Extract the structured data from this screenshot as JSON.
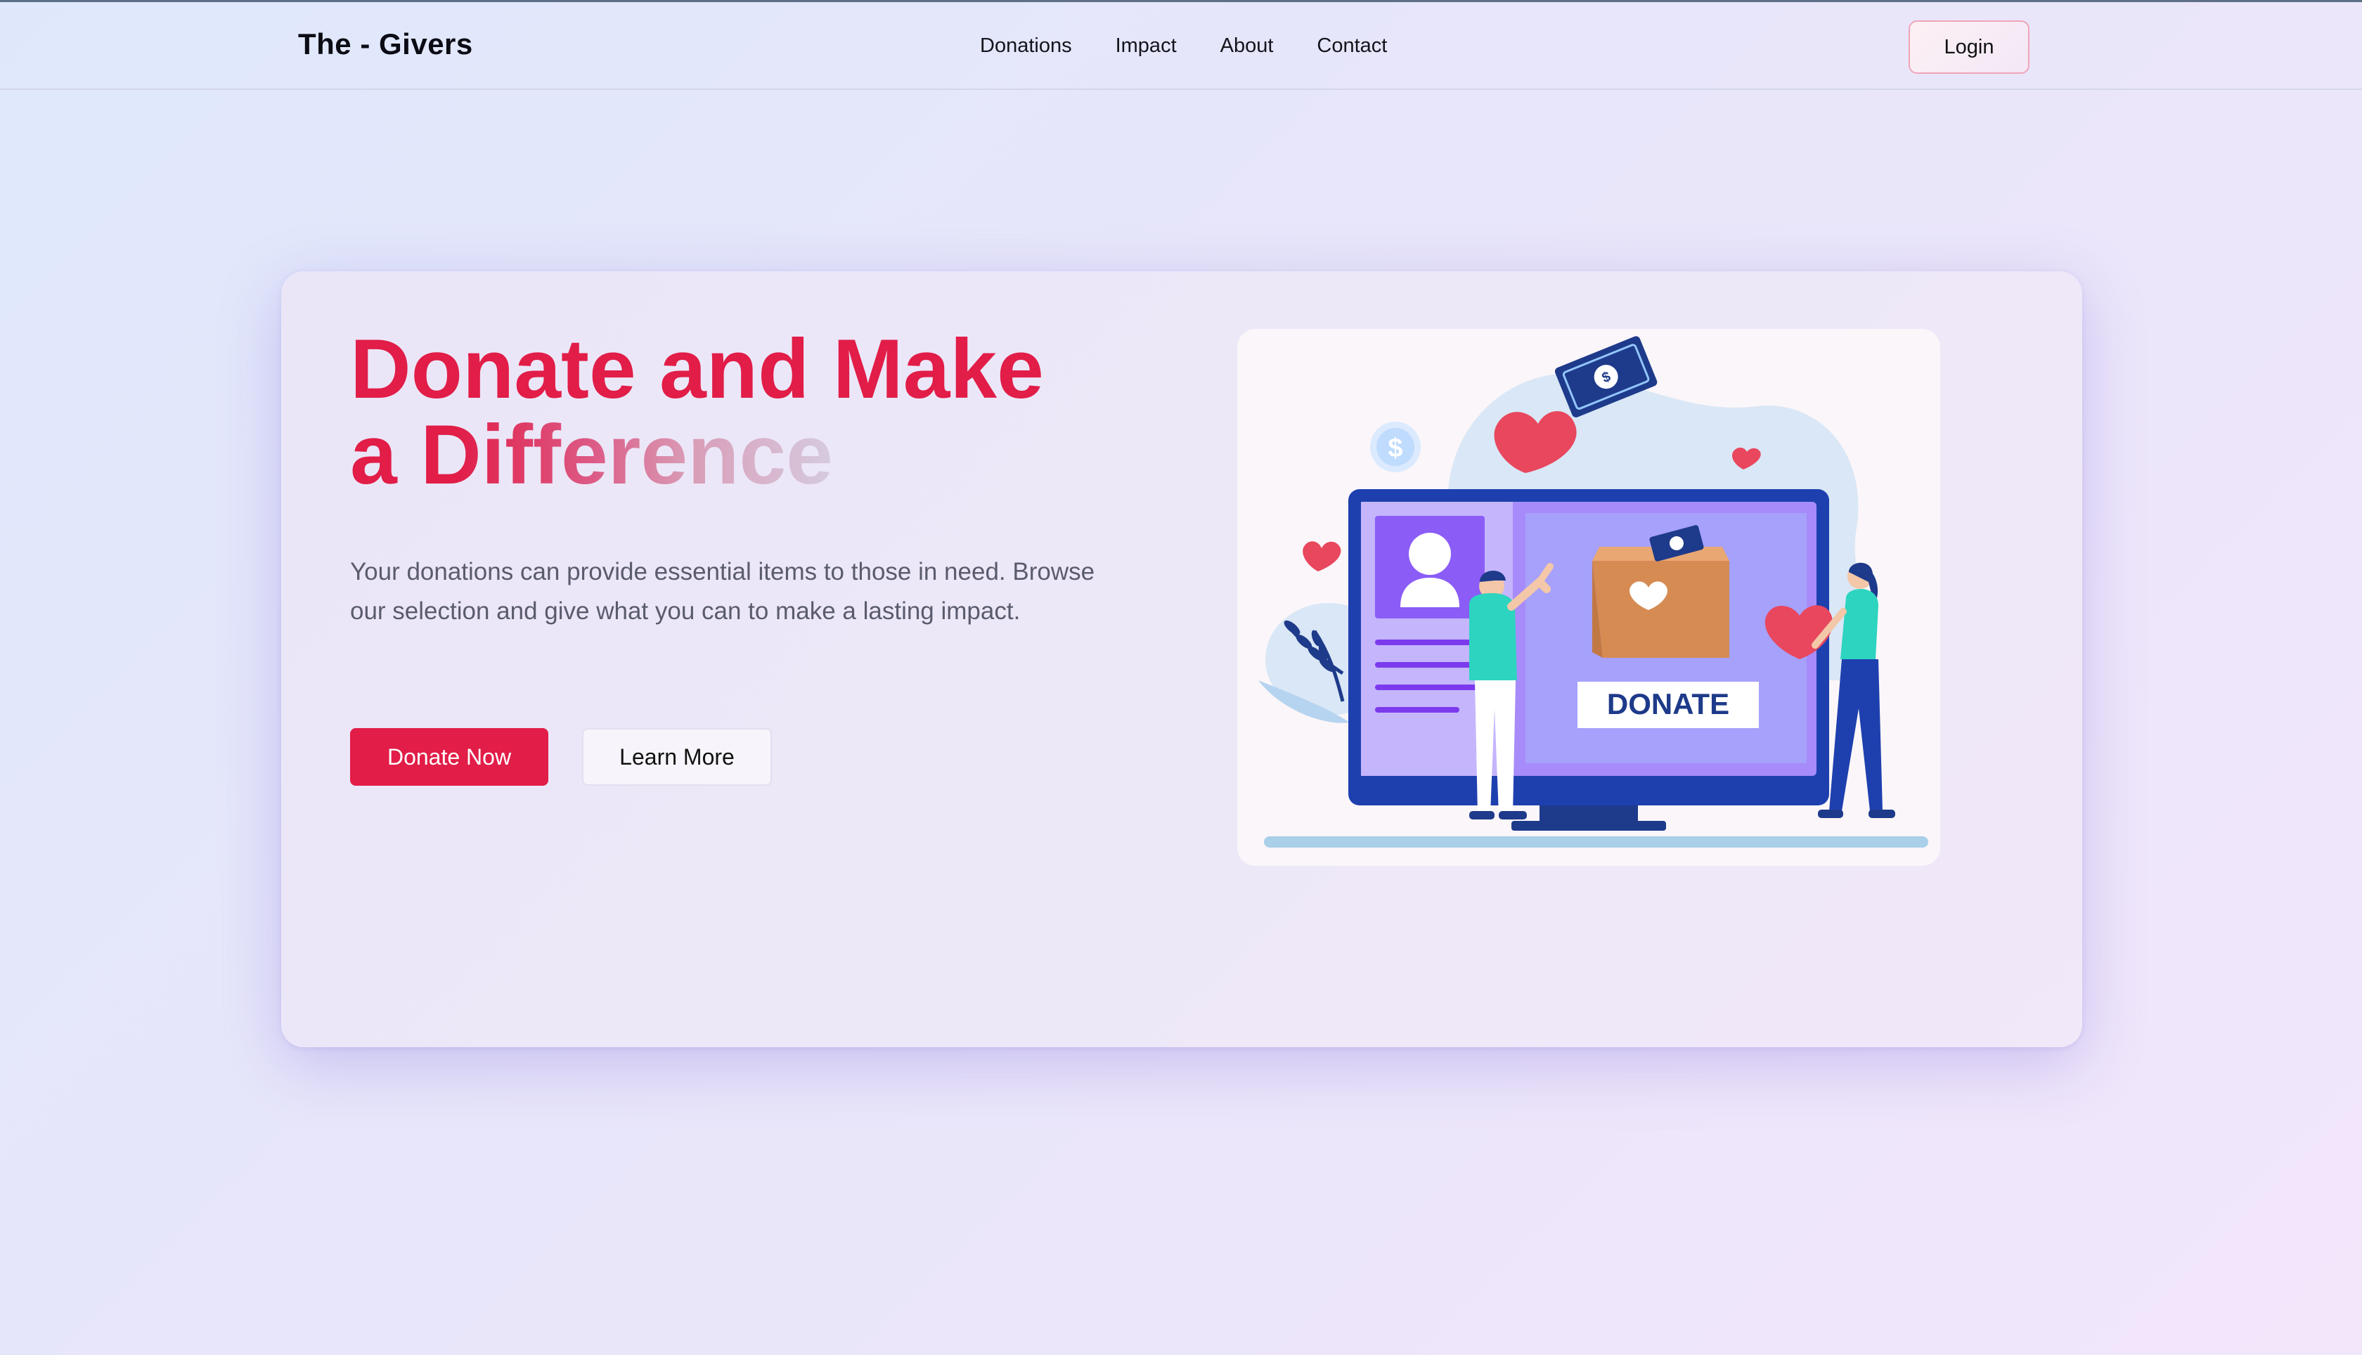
{
  "brand": "The - Givers",
  "nav": {
    "links": [
      "Donations",
      "Impact",
      "About",
      "Contact"
    ],
    "login_label": "Login"
  },
  "hero": {
    "title_line1": "Donate and Make",
    "title_line2": "a Difference",
    "description": "Your donations can provide essential items to those in need. Browse our selection and give what you can to make a lasting impact.",
    "donate_label": "Donate Now",
    "learn_label": "Learn More",
    "illustration": {
      "box_label": "DONATE",
      "coin_symbol": "$"
    }
  },
  "colors": {
    "accent": "#e11d48",
    "monitor": "#1e40af",
    "screen": "#a78bfa"
  }
}
